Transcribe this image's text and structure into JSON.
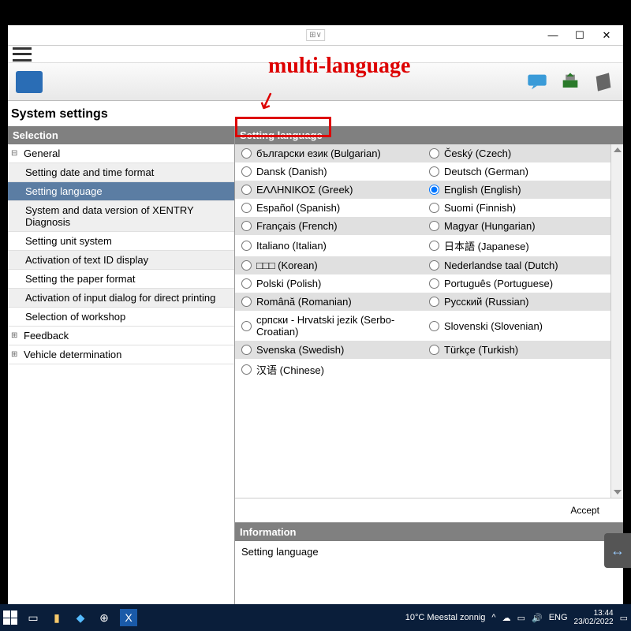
{
  "annotation": {
    "text": "multi-language",
    "arrow": "↙"
  },
  "window": {
    "page_title": "System settings",
    "sidebar_header": "Selection",
    "panel_header": "Setting language",
    "info_header": "Information",
    "info_body": "Setting language",
    "accept_label": "Accept"
  },
  "sidebar": {
    "groups": [
      {
        "label": "General",
        "expanded": true,
        "children": [
          {
            "label": "Setting date and time format",
            "active": false
          },
          {
            "label": "Setting language",
            "active": true
          },
          {
            "label": "System and data version of XENTRY Diagnosis",
            "active": false
          },
          {
            "label": "Setting unit system",
            "active": false
          },
          {
            "label": "Activation of text ID display",
            "active": false
          },
          {
            "label": "Setting the paper format",
            "active": false
          },
          {
            "label": "Activation of input dialog for direct printing",
            "active": false
          },
          {
            "label": "Selection of workshop",
            "active": false
          }
        ]
      },
      {
        "label": "Feedback",
        "expanded": false,
        "children": []
      },
      {
        "label": "Vehicle determination",
        "expanded": false,
        "children": []
      }
    ]
  },
  "languages": [
    {
      "left": {
        "label": "български език (Bulgarian)",
        "selected": false
      },
      "right": {
        "label": "Český (Czech)",
        "selected": false
      }
    },
    {
      "left": {
        "label": "Dansk (Danish)",
        "selected": false
      },
      "right": {
        "label": "Deutsch (German)",
        "selected": false
      }
    },
    {
      "left": {
        "label": "ΕΛΛΗΝΙΚΟΣ (Greek)",
        "selected": false
      },
      "right": {
        "label": "English (English)",
        "selected": true
      }
    },
    {
      "left": {
        "label": "Español (Spanish)",
        "selected": false
      },
      "right": {
        "label": "Suomi (Finnish)",
        "selected": false
      }
    },
    {
      "left": {
        "label": "Français (French)",
        "selected": false
      },
      "right": {
        "label": "Magyar (Hungarian)",
        "selected": false
      }
    },
    {
      "left": {
        "label": "Italiano (Italian)",
        "selected": false
      },
      "right": {
        "label": "日本語 (Japanese)",
        "selected": false
      }
    },
    {
      "left": {
        "label": "□□□ (Korean)",
        "selected": false
      },
      "right": {
        "label": "Nederlandse taal (Dutch)",
        "selected": false
      }
    },
    {
      "left": {
        "label": "Polski (Polish)",
        "selected": false
      },
      "right": {
        "label": "Português (Portuguese)",
        "selected": false
      }
    },
    {
      "left": {
        "label": "Română (Romanian)",
        "selected": false
      },
      "right": {
        "label": "Русский (Russian)",
        "selected": false
      }
    },
    {
      "left": {
        "label": "српски - Hrvatski jezik (Serbo-Croatian)",
        "selected": false
      },
      "right": {
        "label": "Slovenski (Slovenian)",
        "selected": false
      }
    },
    {
      "left": {
        "label": "Svenska (Swedish)",
        "selected": false
      },
      "right": {
        "label": "Türkçe (Turkish)",
        "selected": false
      }
    },
    {
      "left": {
        "label": "汉语 (Chinese)",
        "selected": false
      },
      "right": null
    }
  ],
  "taskbar": {
    "weather": "10°C  Meestal zonnig",
    "lang": "ENG",
    "time": "13:44",
    "date": "23/02/2022"
  }
}
